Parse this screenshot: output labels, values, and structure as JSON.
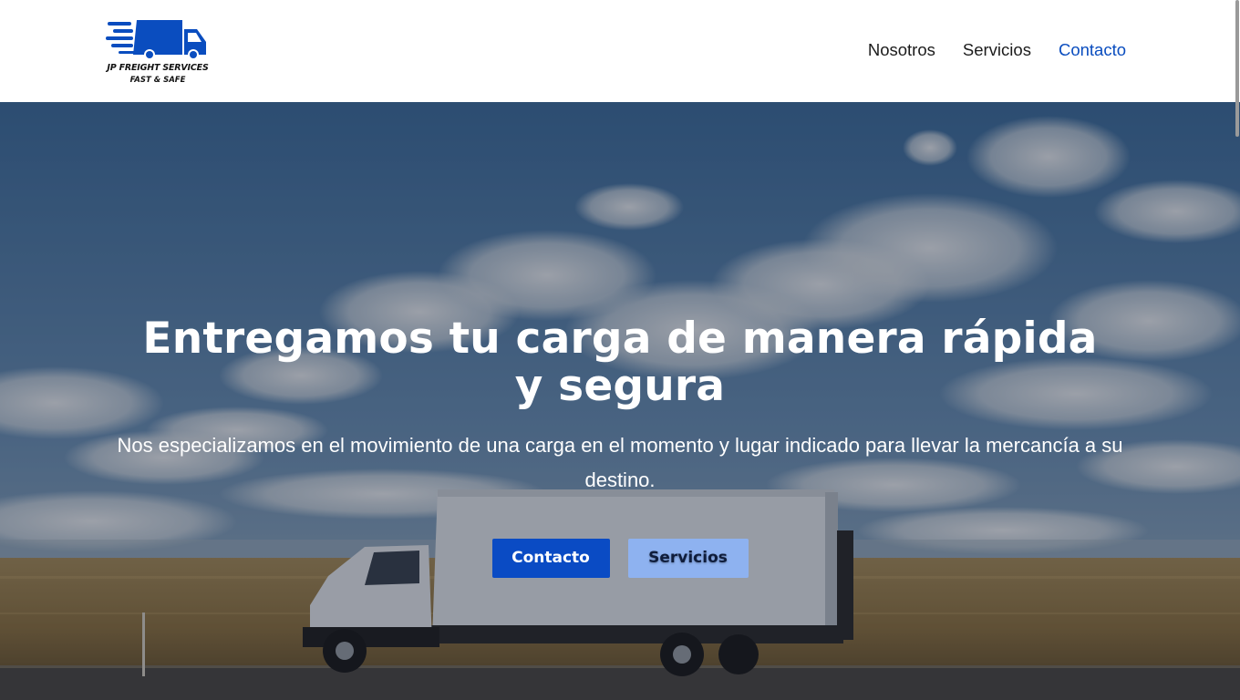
{
  "brand": {
    "name": "JP FREIGHT SERVICES",
    "tagline": "FAST & SAFE",
    "logo_icon": "delivery-truck-icon",
    "color": "#0a4dbf"
  },
  "nav": {
    "items": [
      {
        "label": "Nosotros",
        "active": false
      },
      {
        "label": "Servicios",
        "active": false
      },
      {
        "label": "Contacto",
        "active": true
      }
    ],
    "active_color": "#0a4dbf"
  },
  "hero": {
    "title": "Entregamos tu carga de manera rápida y segura",
    "subtitle": "Nos especializamos en el movimiento de una carga en el momento y lugar indicado para llevar la mercancía a su destino.",
    "background_image": "box-truck-on-highway-under-cloudy-sky",
    "primary_button": {
      "label": "Contacto",
      "color": "#0a4bc4"
    },
    "secondary_button": {
      "label": "Servicios",
      "color": "#8eb2f0"
    }
  }
}
